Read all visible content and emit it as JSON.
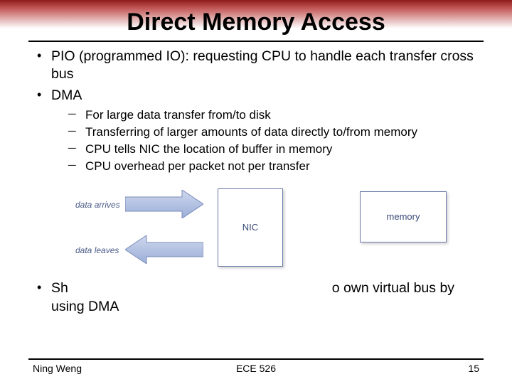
{
  "title": "Direct Memory Access",
  "bullets": {
    "b1": "PIO (programmed IO): requesting CPU to handle each transfer cross bus",
    "b2": "DMA",
    "sub": {
      "s1": "For large data transfer from/to disk",
      "s2": "Transferring of larger amounts of data directly to/from memory",
      "s3": "CPU tells NIC the location of buffer in memory",
      "s4": "CPU overhead per packet not per transfer"
    },
    "b3_left": "Sh",
    "b3_right": "o own virtual bus by using DMA"
  },
  "figure": {
    "arrives": "data arrives",
    "leaves": "data leaves",
    "nic": "NIC",
    "memory": "memory"
  },
  "footer": {
    "left": "Ning Weng",
    "center": "ECE 526",
    "right": "15"
  }
}
